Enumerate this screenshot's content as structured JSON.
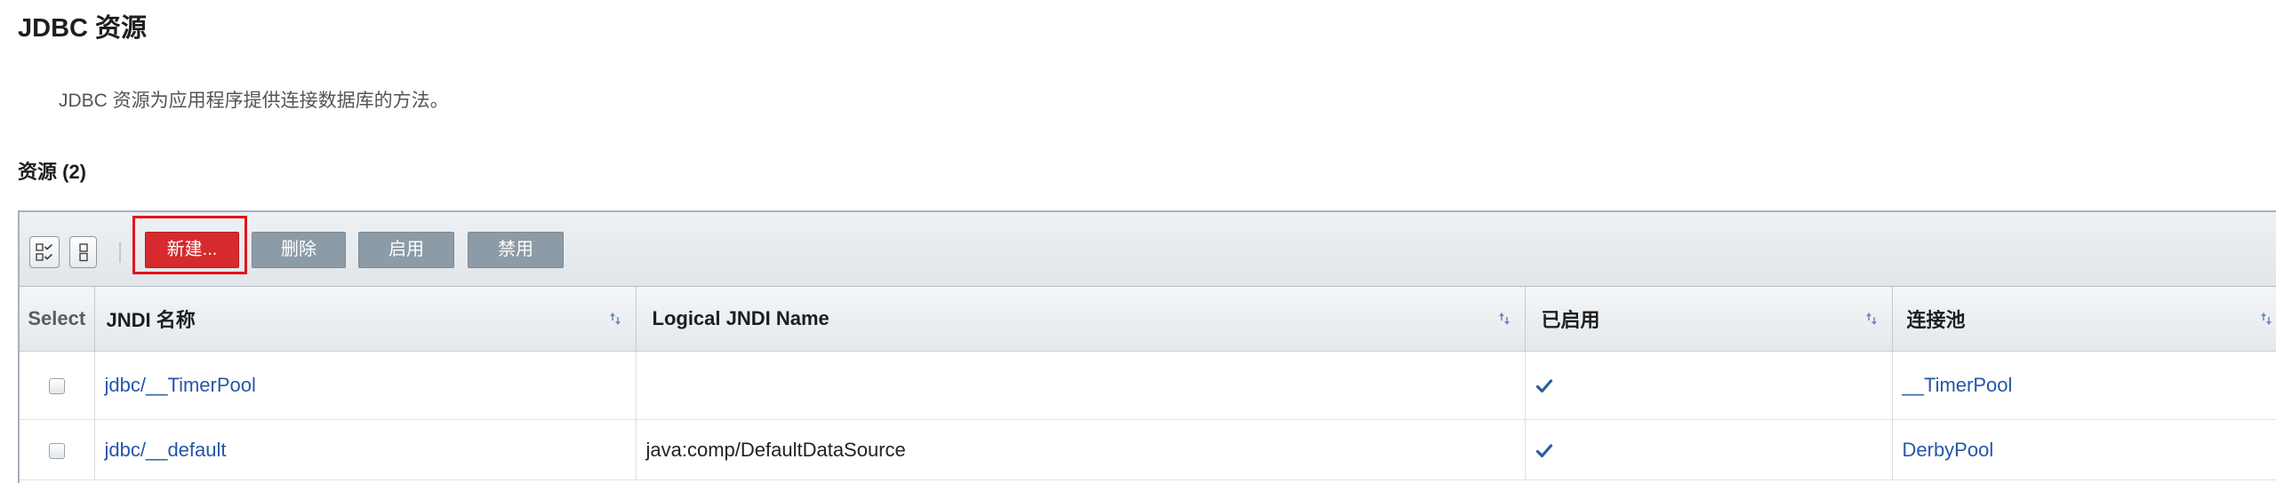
{
  "page": {
    "title": "JDBC 资源",
    "description": "JDBC 资源为应用程序提供连接数据库的方法。"
  },
  "resources_table": {
    "title": "资源 (2)",
    "toolbar": {
      "select_all_icon": "select-all-icon",
      "deselect_all_icon": "deselect-all-icon",
      "new_label": "新建...",
      "delete_label": "删除",
      "enable_label": "启用",
      "disable_label": "禁用",
      "new_button_highlighted": true
    },
    "columns": {
      "select": "Select",
      "jndi_name": "JNDI 名称",
      "logical_jndi_name": "Logical JNDI Name",
      "enabled": "已启用",
      "connection_pool": "连接池"
    },
    "sort_icon": "sort-icon",
    "enabled_icon": "check-icon",
    "rows": [
      {
        "selected": false,
        "jndi_name": "jdbc/__TimerPool",
        "logical_jndi_name": "",
        "enabled": true,
        "connection_pool": "__TimerPool"
      },
      {
        "selected": false,
        "jndi_name": "jdbc/__default",
        "logical_jndi_name": "java:comp/DefaultDataSource",
        "enabled": true,
        "connection_pool": "DerbyPool"
      }
    ]
  },
  "colors": {
    "link": "#2557a7",
    "check_mark": "#2c5c9e",
    "new_button": "#d62a2f",
    "toolbar_button": "#8c9ba6",
    "highlight_outline": "#e4151b",
    "sort_icon": "#6a8db8"
  }
}
